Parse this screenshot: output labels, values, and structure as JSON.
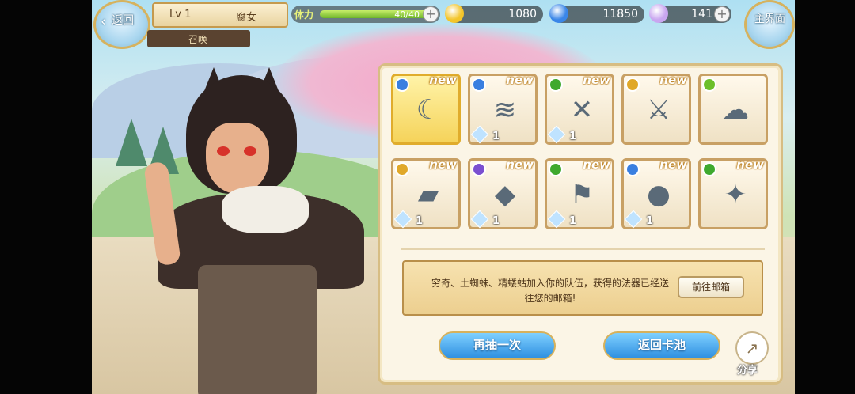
{
  "header": {
    "back_label": "返回",
    "home_label": "主界面",
    "level": "Lv 1",
    "rank": "腐女",
    "tab": "召唤",
    "stamina_label": "体力",
    "stamina_text": "40/40",
    "stamina_fraction": 1.0
  },
  "resources": [
    {
      "name": "gold-coin",
      "amount": "1080",
      "color": "#f3c52a"
    },
    {
      "name": "blue-flame",
      "amount": "11850",
      "color": "#3a86e8"
    },
    {
      "name": "crystal",
      "amount": "141",
      "color": "#c9a6f0"
    }
  ],
  "cards": [
    {
      "name": "scythe",
      "new": "new",
      "elem": "#3a7fe0",
      "icon": "☾",
      "count": "",
      "gold": true
    },
    {
      "name": "claw",
      "new": "new",
      "elem": "#3a7fe0",
      "icon": "≋",
      "count": "1",
      "gold": false
    },
    {
      "name": "crossbow",
      "new": "new",
      "elem": "#3fa92e",
      "icon": "✕",
      "count": "1",
      "gold": false
    },
    {
      "name": "sword",
      "new": "new",
      "elem": "#e0a82a",
      "icon": "⚔",
      "count": "",
      "gold": false
    },
    {
      "name": "spirit",
      "new": "",
      "elem": "#6cbf2a",
      "icon": "☁",
      "count": "",
      "gold": false
    },
    {
      "name": "gold-bar",
      "new": "new",
      "elem": "#e0a82a",
      "icon": "▰",
      "count": "1",
      "gold": false
    },
    {
      "name": "pendulum",
      "new": "new",
      "elem": "#7a4fd0",
      "icon": "◆",
      "count": "1",
      "gold": false
    },
    {
      "name": "flag",
      "new": "new",
      "elem": "#3fa92e",
      "icon": "⚑",
      "count": "1",
      "gold": false
    },
    {
      "name": "orb",
      "new": "new",
      "elem": "#3a7fe0",
      "icon": "●",
      "count": "1",
      "gold": false
    },
    {
      "name": "staff",
      "new": "new",
      "elem": "#3fa92e",
      "icon": "✦",
      "count": "",
      "gold": false
    }
  ],
  "message": {
    "text": "穷奇、土蜘蛛、精蝼蛄加入你的队伍，获得的法器已经送往您的邮箱!",
    "mail_button": "前往邮箱"
  },
  "actions": {
    "draw_again": "再抽一次",
    "back_to_pool": "返回卡池",
    "share": "分享"
  }
}
